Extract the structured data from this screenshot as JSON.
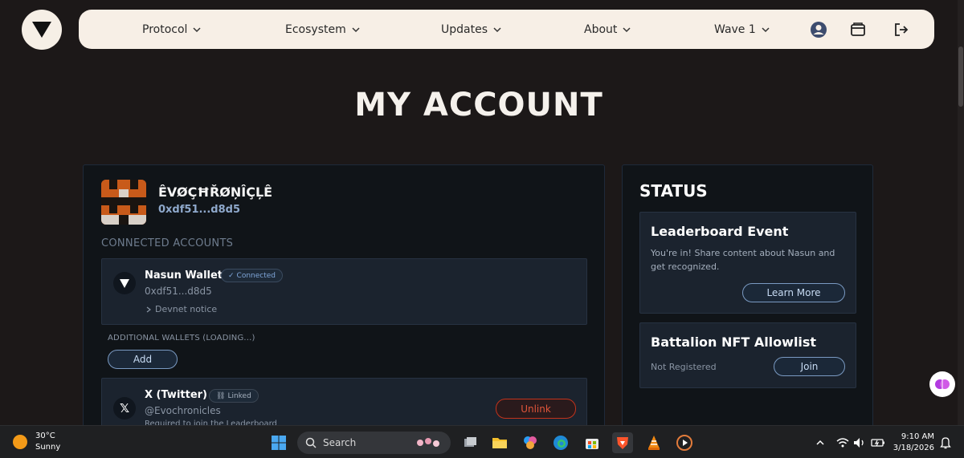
{
  "nav": {
    "items": [
      {
        "label": "Protocol"
      },
      {
        "label": "Ecosystem"
      },
      {
        "label": "Updates"
      },
      {
        "label": "About"
      },
      {
        "label": "Wave 1"
      }
    ],
    "icons": [
      "user-icon",
      "wallet-icon",
      "logout-icon"
    ]
  },
  "page": {
    "title": "MY ACCOUNT"
  },
  "account": {
    "username": "ÊVØÇĦŘØŅÎÇĻÊ",
    "address": "0xdf51...d8d5",
    "connected_label": "CONNECTED ACCOUNTS",
    "wallet": {
      "name": "Nasun Wallet",
      "badge": "Connected",
      "address": "0xdf51...d8d5",
      "notice": "Devnet notice"
    },
    "additional_label": "ADDITIONAL WALLETS (LOADING...)",
    "add_label": "Add",
    "twitter": {
      "name": "X (Twitter)",
      "badge": "Linked",
      "handle": "@Evochronicles",
      "note": "Required to join the Leaderboard",
      "unlink_label": "Unlink"
    }
  },
  "status": {
    "title": "STATUS",
    "leaderboard": {
      "title": "Leaderboard Event",
      "text": "You're in! Share content about Nasun and get recognized.",
      "button": "Learn More"
    },
    "allowlist": {
      "title": "Battalion NFT Allowlist",
      "state": "Not Registered",
      "button": "Join"
    }
  },
  "taskbar": {
    "temperature": "30°C",
    "condition": "Sunny",
    "search_placeholder": "Search",
    "time": "9:10 AM",
    "date": "3/18/2026"
  },
  "colors": {
    "background": "#1c1818",
    "nav_bg": "#f7efe6",
    "card_bg": "#101418",
    "accent_blue": "#7a9ac2",
    "danger": "#c2331c",
    "avatar_orange": "#c85a1a"
  }
}
